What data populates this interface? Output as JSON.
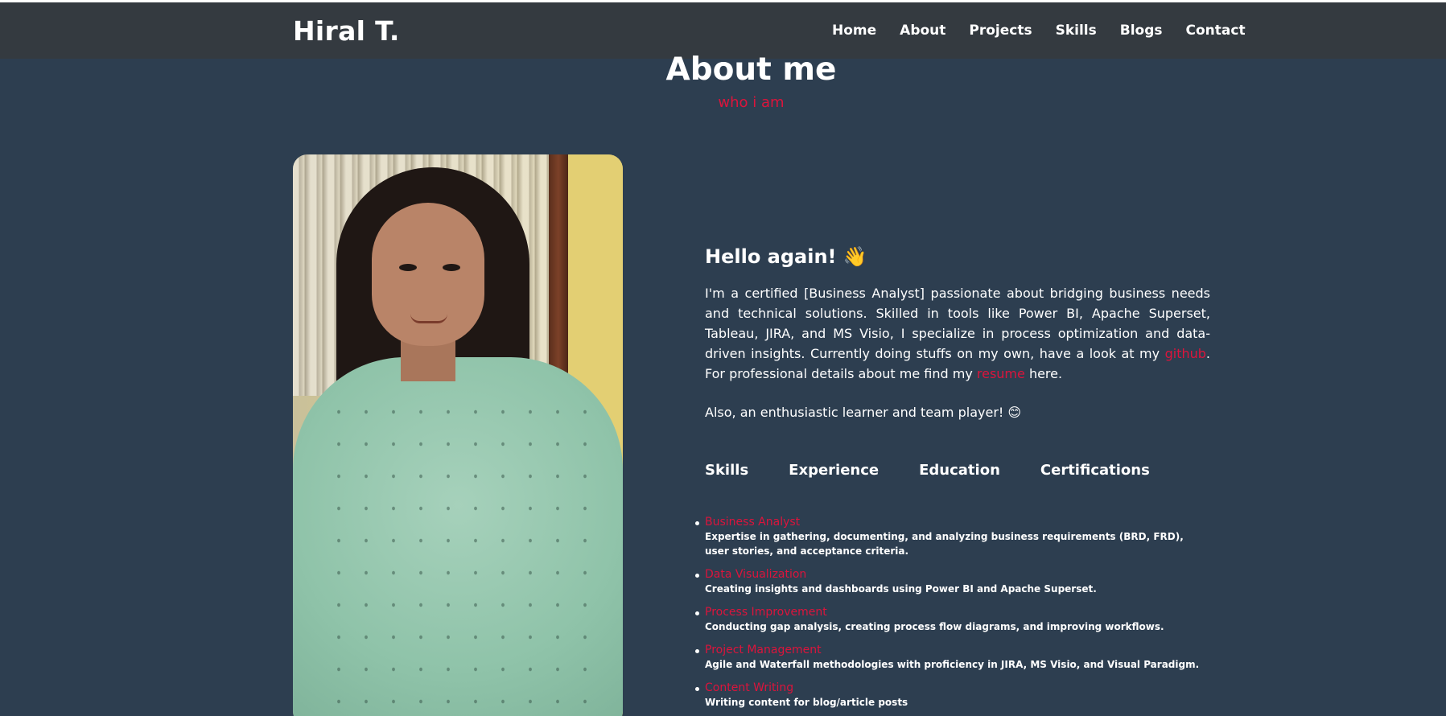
{
  "navbar": {
    "brand": "Hiral T.",
    "links": [
      "Home",
      "About",
      "Projects",
      "Skills",
      "Blogs",
      "Contact"
    ]
  },
  "about": {
    "title": "About me",
    "subtitle": "who i am",
    "greeting": "Hello again! 👋",
    "intro_part1": "I'm a certified [Business Analyst] passionate about bridging business needs and technical solutions. Skilled in tools like Power BI, Apache Superset, Tableau, JIRA, and MS Visio, I specialize in process optimization and data-driven insights. Currently doing stuffs on my own, have a look at my ",
    "github_link": "github",
    "intro_part2": ". For professional details about me find my ",
    "resume_link": "resume",
    "intro_part3": " here.",
    "also": "Also, an enthusiastic learner and team player! 😊"
  },
  "tabs": [
    "Skills",
    "Experience",
    "Education",
    "Certifications"
  ],
  "skills": [
    {
      "name": "Business Analyst",
      "desc": "Expertise in gathering, documenting, and analyzing business requirements (BRD, FRD), user stories, and acceptance criteria."
    },
    {
      "name": "Data Visualization",
      "desc": "Creating insights and dashboards using Power BI and Apache Superset."
    },
    {
      "name": "Process Improvement",
      "desc": "Conducting gap analysis, creating process flow diagrams, and improving workflows."
    },
    {
      "name": "Project Management",
      "desc": "Agile and Waterfall methodologies with proficiency in JIRA, MS Visio, and Visual Paradigm."
    },
    {
      "name": "Content Writing",
      "desc": "Writing content for blog/article posts"
    }
  ],
  "colors": {
    "background": "#2d3e50",
    "navbar": "#343a40",
    "accent": "#dc143c",
    "text": "#ffffff"
  }
}
